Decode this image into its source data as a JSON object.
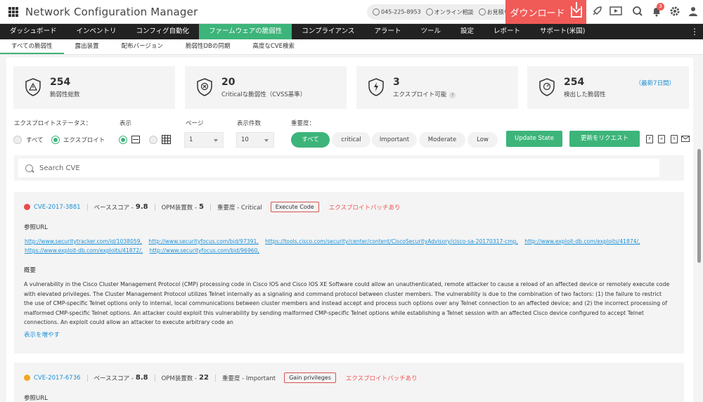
{
  "header": {
    "title": "Network Configuration Manager",
    "phone": "045-225-8953",
    "online_consult": "オンライン相談",
    "quote": "お見積り",
    "download": "ダウンロード",
    "notif_count": "3"
  },
  "nav": [
    "ダッシュボード",
    "インベントリ",
    "コンフィグ自動化",
    "ファームウェアの脆弱性",
    "コンプライアンス",
    "アラート",
    "ツール",
    "設定",
    "レポート",
    "サポート(米国)"
  ],
  "subtabs": [
    "すべての脆弱性",
    "露出装置",
    "配布バージョン",
    "脆弱性DBの同期",
    "高度なCVE検索"
  ],
  "stats": [
    {
      "value": "254",
      "label": "脆弱性総数"
    },
    {
      "value": "20",
      "label": "Criticalな脆弱性（CVSS基準）"
    },
    {
      "value": "3",
      "label": "エクスプロイト可能"
    },
    {
      "value": "254",
      "label": "検出した脆弱性",
      "extra": "（最新7日間）"
    }
  ],
  "filters": {
    "exploit_status_label": "エクスプロイトステータス：",
    "all": "すべて",
    "exploit": "エクスプロイト",
    "view_label": "表示",
    "page_label": "ページ",
    "page_value": "1",
    "count_label": "表示件数",
    "count_value": "10",
    "severity_label": "重要度：",
    "severity_options": [
      "すべて",
      "critical",
      "Important",
      "Moderate",
      "Low"
    ],
    "update_state": "Update State",
    "request_update": "更新をリクエスト"
  },
  "search": {
    "placeholder": "Search CVE"
  },
  "cves": [
    {
      "id": "CVE-2017-3881",
      "color": "#e74c4c",
      "base_label": "ベーススコア -",
      "base_score": "9.8",
      "opm_label": "OPM装置数 -",
      "opm_count": "5",
      "severity": "重要度 - Critical",
      "tag": "Execute Code",
      "exploit": "エクスプロイトパッチあり",
      "ref_title": "参照URL",
      "links": [
        "http://www.securitytracker.com/id/1038059,",
        "http://www.securityfocus.com/bid/97391,",
        "https://tools.cisco.com/security/center/content/CiscoSecurityAdvisory/cisco-sa-20170317-cmp,",
        "http://www.exploit-db.com/exploits/41874/,",
        "https://www.exploit-db.com/exploits/41872/,",
        "http://www.securityfocus.com/bid/96960,"
      ],
      "summary_title": "概要",
      "summary": "A vulnerability in the Cisco Cluster Management Protocol (CMP) processing code in Cisco IOS and Cisco IOS XE Software could allow an unauthenticated, remote attacker to cause a reload of an affected device or remotely execute code with elevated privileges. The Cluster Management Protocol utilizes Telnet internally as a signaling and command protocol between cluster members. The vulnerability is due to the combination of two factors: (1) the failure to restrict the use of CMP-specific Telnet options only to internal, local communications between cluster members and instead accept and process such options over any Telnet connection to an affected device; and (2) the incorrect processing of malformed CMP-specific Telnet options. An attacker could exploit this vulnerability by sending malformed CMP-specific Telnet options while establishing a Telnet session with an affected Cisco device configured to accept Telnet connections. An exploit could allow an attacker to execute arbitrary code an",
      "show_more": "表示を増やす"
    },
    {
      "id": "CVE-2017-6736",
      "color": "#f2a623",
      "base_label": "ベーススコア -",
      "base_score": "8.8",
      "opm_label": "OPM装置数 -",
      "opm_count": "22",
      "severity": "重要度 - Important",
      "tag": "Gain privileges",
      "exploit": "エクスプロイトパッチあり",
      "ref_title": "参照URL"
    }
  ]
}
